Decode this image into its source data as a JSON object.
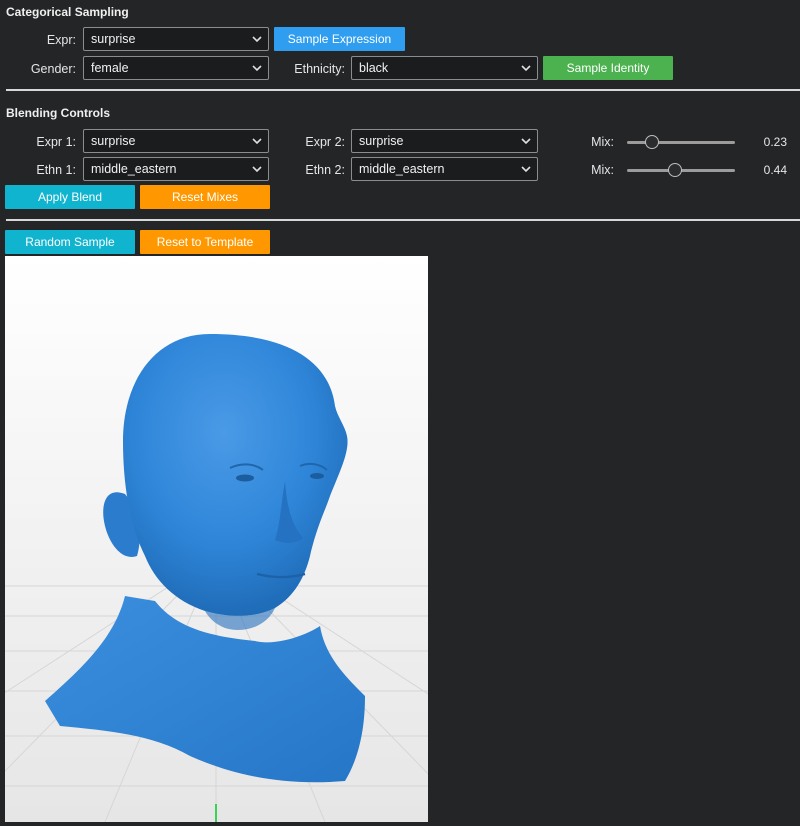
{
  "categorical_sampling": {
    "title": "Categorical Sampling",
    "expr_label": "Expr:",
    "expr_value": "surprise",
    "sample_expression_label": "Sample Expression",
    "gender_label": "Gender:",
    "gender_value": "female",
    "ethnicity_label": "Ethnicity:",
    "ethnicity_value": "black",
    "sample_identity_label": "Sample Identity"
  },
  "blending_controls": {
    "title": "Blending Controls",
    "expr1_label": "Expr 1:",
    "expr1_value": "surprise",
    "expr2_label": "Expr 2:",
    "expr2_value": "surprise",
    "ethn1_label": "Ethn 1:",
    "ethn1_value": "middle_eastern",
    "ethn2_label": "Ethn 2:",
    "ethn2_value": "middle_eastern",
    "mix1_label": "Mix:",
    "mix1_value": "0.23",
    "mix2_label": "Mix:",
    "mix2_value": "0.44",
    "apply_blend_label": "Apply Blend",
    "reset_mixes_label": "Reset Mixes"
  },
  "actions": {
    "random_sample_label": "Random Sample",
    "reset_template_label": "Reset to Template"
  },
  "viewport": {
    "mesh_color": "#2f86d9",
    "background_color": "#f2f2f2",
    "grid_color": "#d4d4d4",
    "axis_color": "#39d353"
  },
  "colors": {
    "background": "#232527",
    "blue_button": "#2f9ef0",
    "green_button": "#4cb24f",
    "cyan_button": "#11b4cf",
    "orange_button": "#ff9800"
  },
  "icons": {
    "dropdown": "chevron-down-icon"
  }
}
